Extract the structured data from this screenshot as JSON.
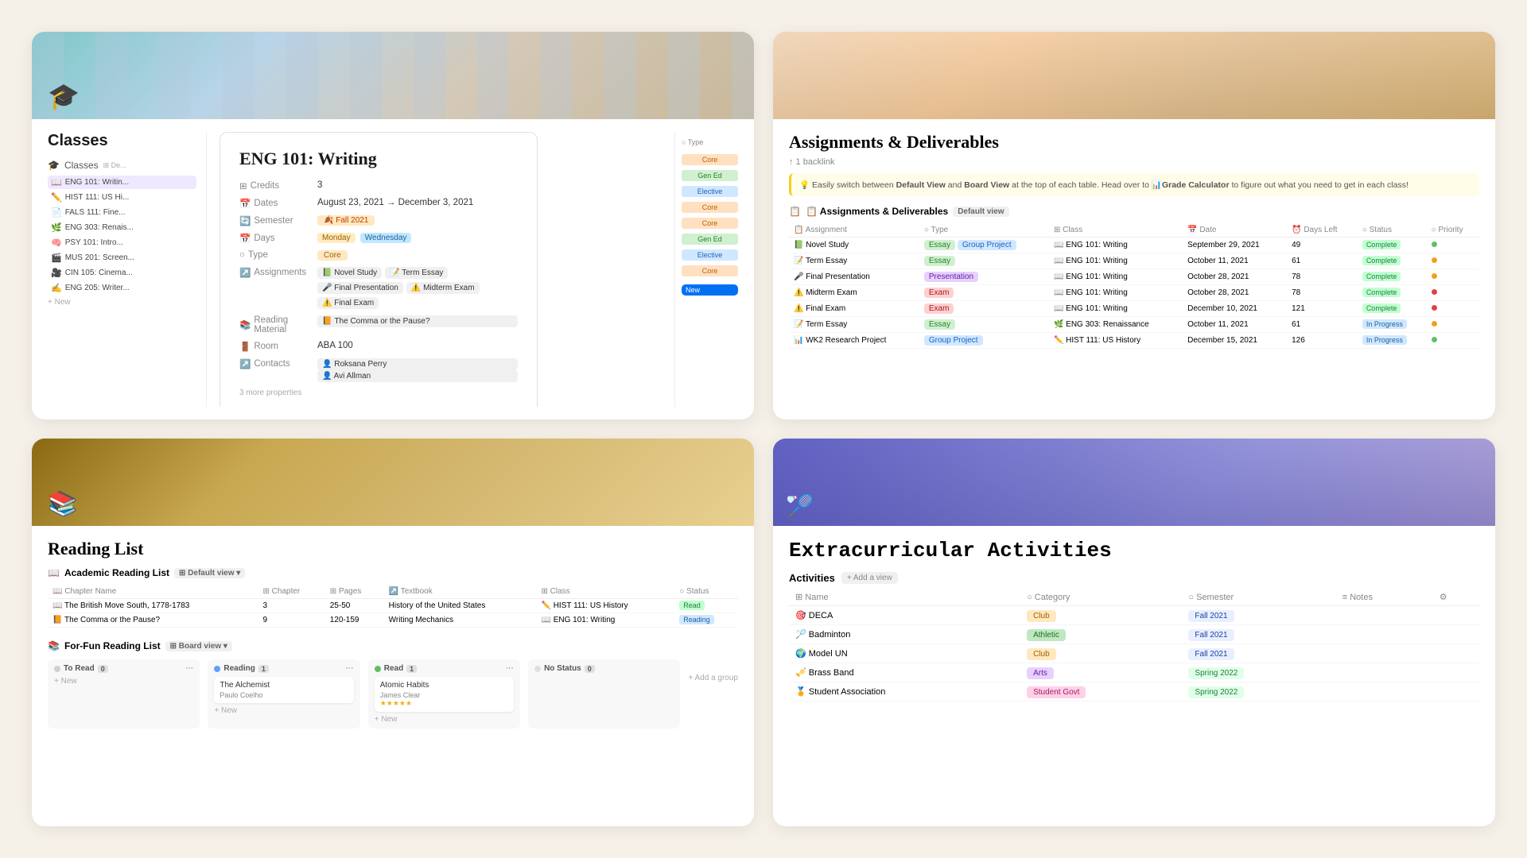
{
  "card1": {
    "title": "Classes",
    "sidebar_section": "Classes",
    "sidebar_emoji": "🎓",
    "items": [
      {
        "icon": "📖",
        "label": "ENG 101: Writing"
      },
      {
        "icon": "✏️",
        "label": "HIST 111: US Hi..."
      },
      {
        "icon": "📄",
        "label": "FALS 111: Fine..."
      },
      {
        "icon": "🌿",
        "label": "ENG 303: Renais..."
      },
      {
        "icon": "🧠",
        "label": "PSY 101: Intro..."
      },
      {
        "icon": "🎬",
        "label": "MUS 201: Screen..."
      },
      {
        "icon": "🎥",
        "label": "CIN 105: Cinema..."
      },
      {
        "icon": "✍️",
        "label": "ENG 205: Writer..."
      }
    ],
    "new_btn": "New",
    "detail": {
      "title": "ENG 101: Writing",
      "credits_label": "Credits",
      "credits_value": "3",
      "dates_label": "Dates",
      "dates_value": "August 23, 2021 → December 3, 2021",
      "semester_label": "Semester",
      "semester_value": "Fall 2021",
      "days_label": "Days",
      "days": [
        "Monday",
        "Wednesday"
      ],
      "type_label": "Type",
      "type_value": "Core",
      "assignments_label": "Assignments",
      "assignments": [
        "Novel Study",
        "Term Essay",
        "Final Presentation",
        "Midterm Exam",
        "Final Exam"
      ],
      "reading_label": "Reading Material",
      "reading_value": "The Comma or the Pause?",
      "room_label": "Room",
      "room_value": "ABA 100",
      "contacts_label": "Contacts",
      "contacts": [
        "Roksana Perry",
        "Avi Allman"
      ],
      "more": "3 more properties"
    },
    "right_types": [
      "Core",
      "Gen Ed",
      "Elective",
      "Core",
      "Core",
      "Gen Ed",
      "Elective",
      "Core"
    ]
  },
  "card2": {
    "title": "Assignments & Deliverables",
    "backlink": "↑ 1 backlink",
    "info": "💡 Easily switch between Default View and Board View at the top of each table. Head over to 📊Grade Calculator to figure out what you need to get in each class!",
    "table_title": "📋 Assignments & Deliverables",
    "view_label": "Default view",
    "columns": [
      "Assignment",
      "Type",
      "Class",
      "Date",
      "Days Left",
      "Status",
      "Priority"
    ],
    "rows": [
      {
        "name": "Novel Study",
        "type": "Essay Group Project",
        "class": "ENG 101: Writing",
        "date": "September 29, 2021",
        "days": "49",
        "status": "Complete",
        "priority": "low"
      },
      {
        "name": "Term Essay",
        "type": "Essay",
        "class": "ENG 101: Writing",
        "date": "October 11, 2021",
        "days": "61",
        "status": "Complete",
        "priority": "mid"
      },
      {
        "name": "Final Presentation",
        "type": "Presentation",
        "class": "ENG 101: Writing",
        "date": "October 28, 2021",
        "days": "78",
        "status": "Complete",
        "priority": "mid"
      },
      {
        "name": "Midterm Exam",
        "type": "Exam",
        "class": "ENG 101: Writing",
        "date": "October 28, 2021",
        "days": "78",
        "status": "Complete",
        "priority": "important"
      },
      {
        "name": "Final Exam",
        "type": "Exam",
        "class": "ENG 101: Writing",
        "date": "December 10, 2021",
        "days": "121",
        "status": "Complete",
        "priority": "important"
      },
      {
        "name": "Term Essay",
        "type": "Essay",
        "class": "ENG 303: Renaissance",
        "date": "October 11, 2021",
        "days": "61",
        "status": "In Progress",
        "priority": "mid"
      },
      {
        "name": "WK2 Research Project",
        "type": "Group Project",
        "class": "HIST 111: US History",
        "date": "December 15, 2021",
        "days": "126",
        "status": "In Progress",
        "priority": "low"
      }
    ]
  },
  "card3": {
    "title": "Reading List",
    "icon": "📚",
    "academic_table_title": "📖 Academic Reading List",
    "academic_view": "Default view",
    "academic_columns": [
      "Chapter Name",
      "Chapter",
      "Pages",
      "Textbook",
      "Class",
      "Status"
    ],
    "academic_rows": [
      {
        "name": "The British Move South, 1778-1783",
        "chapter": "3",
        "pages": "25-50",
        "textbook": "History of the United States",
        "class": "HIST 111: US History",
        "status": "Read"
      },
      {
        "name": "The Comma or the Pause?",
        "chapter": "9",
        "pages": "120-159",
        "textbook": "Writing Mechanics",
        "class": "ENG 101: Writing",
        "status": "Reading"
      }
    ],
    "fun_title": "📚 For-Fun Reading List",
    "fun_view": "Board view",
    "kanban": {
      "to_read": {
        "label": "To Read",
        "count": "0",
        "items": []
      },
      "reading": {
        "label": "Reading",
        "count": "1",
        "items": [
          {
            "title": "The Alchemist",
            "author": "Paulo Coelho"
          }
        ]
      },
      "read": {
        "label": "Read",
        "count": "1",
        "items": [
          {
            "title": "Atomic Habits",
            "author": "James Clear",
            "stars": "★★★★★"
          }
        ]
      },
      "no_status": {
        "label": "No Status",
        "count": "0",
        "items": []
      }
    }
  },
  "card4": {
    "icon": "🏸",
    "title": "Extracurricular Activities",
    "table_title": "Activities",
    "add_view": "+ Add a view",
    "columns": [
      "Name",
      "Category",
      "Semester",
      "Notes"
    ],
    "rows": [
      {
        "icon": "🎯",
        "name": "DECA",
        "category": "Club",
        "cat_class": "cat-club",
        "semester": "Fall 2021",
        "sem_class": "sem-fall21"
      },
      {
        "icon": "🏸",
        "name": "Badminton",
        "category": "Athletic",
        "cat_class": "cat-athletic",
        "semester": "Fall 2021",
        "sem_class": "sem-fall21"
      },
      {
        "icon": "🌍",
        "name": "Model UN",
        "category": "Club",
        "cat_class": "cat-club",
        "semester": "Fall 2021",
        "sem_class": "sem-fall21"
      },
      {
        "icon": "🎺",
        "name": "Brass Band",
        "category": "Arts",
        "cat_class": "cat-arts",
        "semester": "Spring 2022",
        "sem_class": "sem-spring22"
      },
      {
        "icon": "🏅",
        "name": "Student Association",
        "category": "Student Govt",
        "cat_class": "cat-govn",
        "semester": "Spring 2022",
        "sem_class": "sem-spring22"
      }
    ]
  }
}
